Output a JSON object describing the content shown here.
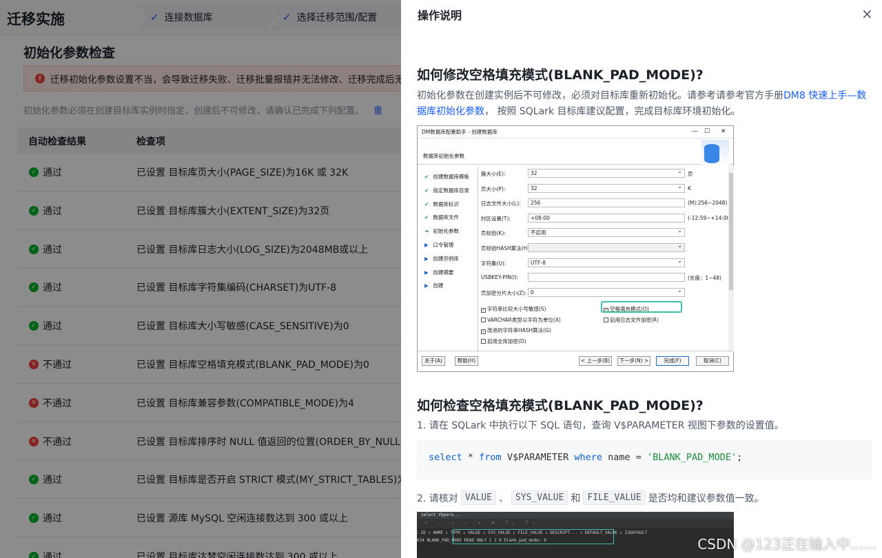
{
  "app": {
    "title": "迁移实施",
    "steps": [
      "连接数据库",
      "选择迁移范围/配置"
    ]
  },
  "section": {
    "title": "初始化参数检查",
    "alert": "迁移初始化参数设置不当，会导致迁移失败、迁移批量报错并无法修改、迁移完成后无",
    "hint": "初始化参数必须在创建目标库实例时指定，创建后不可修改，请确认已完成下列配置。",
    "hint_link": "重"
  },
  "table": {
    "headers": [
      "自动检查结果",
      "检查项"
    ],
    "rows": [
      {
        "status": "通过",
        "ok": true,
        "item": "已设置 目标库页大小(PAGE_SIZE)为16K 或 32K"
      },
      {
        "status": "通过",
        "ok": true,
        "item": "已设置 目标库簇大小(EXTENT_SIZE)为32页"
      },
      {
        "status": "通过",
        "ok": true,
        "item": "已设置 目标库日志大小(LOG_SIZE)为2048MB或以上"
      },
      {
        "status": "通过",
        "ok": true,
        "item": "已设置 目标库字符集编码(CHARSET)为UTF-8"
      },
      {
        "status": "通过",
        "ok": true,
        "item": "已设置 目标库大小写敏感(CASE_SENSITIVE)为0"
      },
      {
        "status": "不通过",
        "ok": false,
        "item": "已设置 目标库空格填充模式(BLANK_PAD_MODE)为0"
      },
      {
        "status": "不通过",
        "ok": false,
        "item": "已设置 目标库兼容参数(COMPATIBLE_MODE)为4"
      },
      {
        "status": "不通过",
        "ok": false,
        "item": "已设置 目标库排序时 NULL 值返回的位置(ORDER_BY_NULLS_"
      },
      {
        "status": "通过",
        "ok": true,
        "item": "已设置 目标库是否开启 STRICT 模式(MY_STRICT_TABLES)为1"
      },
      {
        "status": "通过",
        "ok": true,
        "item": "已设置 源库 MySQL 空闲连接数达到 300 或以上"
      },
      {
        "status": "通过",
        "ok": true,
        "item": "已设置 目标库达梦空闲连接数达到 300 或以上"
      }
    ]
  },
  "drawer": {
    "title": "操作说明",
    "close": "×",
    "h1": "如何修改空格填充模式(BLANK_PAD_MODE)?",
    "p1_a": "初始化参数在创建实例后不可修改，必须对目标库重新初始化。请参考请参考官方手册",
    "p1_link": "DM8 快速上手—数据库初始化参数",
    "p1_b": "， 按照 SQLark 目标库建议配置，完成目标库环境初始化。",
    "h2": "如何检查空格填充模式(BLANK_PAD_MODE)?",
    "step1": "1. 请在 SQLark 中执行以下 SQL 语句，查询 V$PARAMETER 视图下参数的设置值。",
    "code": {
      "kw1": "select",
      "mid1": " * ",
      "kw2": "from",
      "mid2": " V$PARAMETER ",
      "kw3": "where",
      "mid3": " name = ",
      "str": "'BLANK_PAD_MODE'",
      "end": ";"
    },
    "step2_a": "2. 请核对",
    "chip1": "VALUE",
    "sep1": "、",
    "chip2": "SYS_VALUE",
    "sep2": "和",
    "chip3": "FILE_VALUE",
    "step2_b": "是否均和建议参数值一致。"
  },
  "dialog": {
    "title": "DM数据库配置助手 - 创建数据库",
    "section": "数据库初始化参数",
    "steps": [
      {
        "mark": "✔",
        "label": "创建数据库模板"
      },
      {
        "mark": "✔",
        "label": "指定数据库目录"
      },
      {
        "mark": "✔",
        "label": "数据库标识"
      },
      {
        "mark": "✔",
        "label": "数据库文件"
      },
      {
        "mark": "➔",
        "label": "初始化参数"
      },
      {
        "mark": "▶",
        "label": "口令管理"
      },
      {
        "mark": "▶",
        "label": "创建示例库"
      },
      {
        "mark": "▶",
        "label": "创建摘要"
      },
      {
        "mark": "▶",
        "label": "创建"
      }
    ],
    "fields": [
      {
        "label": "簇大小(E):",
        "value": "32",
        "note": "页"
      },
      {
        "label": "页大小(P):",
        "value": "32",
        "note": "K"
      },
      {
        "label": "日志文件大小(L):",
        "value": "256",
        "note": "(M):256~2048)"
      },
      {
        "label": "时区设置(T):",
        "value": "+08:00",
        "note": "(-12:59~+14:00)"
      },
      {
        "label": "页校验(K):",
        "value": "不启用",
        "note": ""
      },
      {
        "label": "页校验HASH算法(H):",
        "value": "",
        "note": ""
      },
      {
        "label": "字符集(U):",
        "value": "UTF-8",
        "note": ""
      },
      {
        "label": "USBKEY-PIN(I):",
        "value": "",
        "note": "(长度：1~48)"
      },
      {
        "label": "页加密分片大小(Z):",
        "value": "0",
        "note": ""
      }
    ],
    "checks": [
      {
        "label": "字符串比较大小写敏感(S)",
        "checked": true
      },
      {
        "label": "空格填充模式(O)",
        "checked": true
      },
      {
        "label": "VARCHAR类型以字符为单位(X)",
        "checked": false
      },
      {
        "label": "启用日志文件加密(R)",
        "checked": false
      },
      {
        "label": "改进的字符串HASH算法(G)",
        "checked": true
      },
      {
        "label": "启用全库加密(D)",
        "checked": false
      }
    ],
    "buttons": [
      "关于(A)",
      "帮助(H)",
      "< 上一步(B)",
      "下一步(N) >",
      "完成(F)",
      "取消(C)"
    ]
  },
  "result_shot": {
    "tab": "select V$para...",
    "toolbar": "+ − ↶ ✓ ✕ ⟳ T₁ T₂",
    "headers": "⁝ ID ⇕  NAME      ⇕ TYPE ⇕ VALUE ⇕ SYS_VALUE ⇕ FILE_VALUE ⇕ DESCRIPT... ⇕ DEFAULT_VALUE ⇕ ISDEFAULT",
    "row": "  634 BLANK_PAD_MODE  READ ONLY  1       1        0     blank_pad_mode: 0"
  },
  "watermark": "CSDN @123正在输入中......"
}
